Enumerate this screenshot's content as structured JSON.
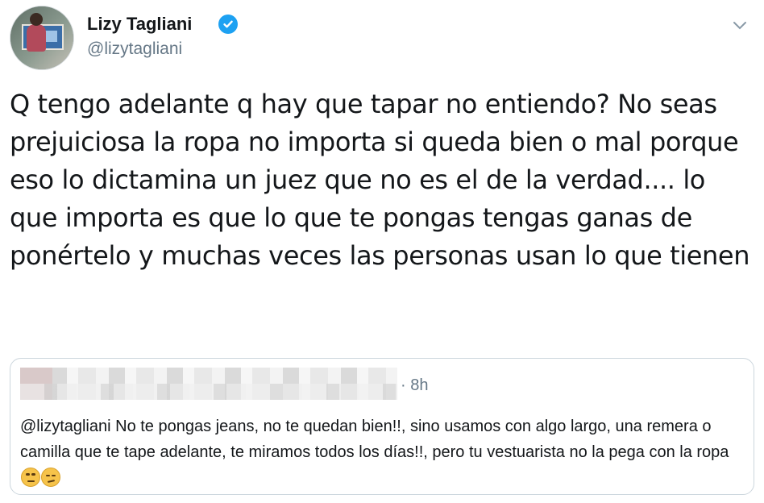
{
  "user": {
    "name": "Lizy Tagliani",
    "handle": "@lizytagliani",
    "verified_icon": "verified-badge-icon",
    "menu_icon": "chevron-down-icon"
  },
  "tweet": {
    "text": "Q tengo adelante q hay que tapar no entiendo? No seas prejuiciosa la ropa no importa si queda bien o mal porque eso lo dictamina un juez que no es el de la verdad.... lo que importa es que lo que te pongas tengas ganas de ponértelo y muchas veces las personas usan lo que tienen"
  },
  "quoted": {
    "time": "· 8h",
    "text": "@lizytagliani No te pongas jeans, no te quedan bien!!, sino usamos con algo largo, una remera o camilla que te tape adelante, te miramos todos los días!!, pero tu vestuarista no la pega con la ropa",
    "emojis": [
      "rolling-eyes-emoji",
      "smirk-emoji"
    ]
  },
  "colors": {
    "verified": "#1da1f2",
    "secondary_text": "#657786",
    "border": "#ccd6dd"
  }
}
